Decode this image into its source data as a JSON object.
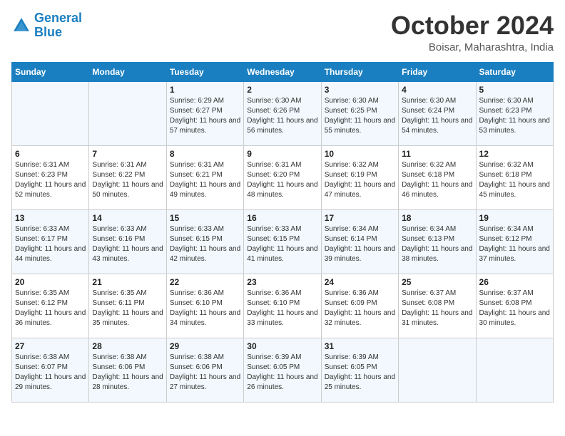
{
  "logo": {
    "line1": "General",
    "line2": "Blue"
  },
  "title": "October 2024",
  "location": "Boisar, Maharashtra, India",
  "days_of_week": [
    "Sunday",
    "Monday",
    "Tuesday",
    "Wednesday",
    "Thursday",
    "Friday",
    "Saturday"
  ],
  "weeks": [
    [
      {
        "day": "",
        "sunrise": "",
        "sunset": "",
        "daylight": ""
      },
      {
        "day": "",
        "sunrise": "",
        "sunset": "",
        "daylight": ""
      },
      {
        "day": "1",
        "sunrise": "Sunrise: 6:29 AM",
        "sunset": "Sunset: 6:27 PM",
        "daylight": "Daylight: 11 hours and 57 minutes."
      },
      {
        "day": "2",
        "sunrise": "Sunrise: 6:30 AM",
        "sunset": "Sunset: 6:26 PM",
        "daylight": "Daylight: 11 hours and 56 minutes."
      },
      {
        "day": "3",
        "sunrise": "Sunrise: 6:30 AM",
        "sunset": "Sunset: 6:25 PM",
        "daylight": "Daylight: 11 hours and 55 minutes."
      },
      {
        "day": "4",
        "sunrise": "Sunrise: 6:30 AM",
        "sunset": "Sunset: 6:24 PM",
        "daylight": "Daylight: 11 hours and 54 minutes."
      },
      {
        "day": "5",
        "sunrise": "Sunrise: 6:30 AM",
        "sunset": "Sunset: 6:23 PM",
        "daylight": "Daylight: 11 hours and 53 minutes."
      }
    ],
    [
      {
        "day": "6",
        "sunrise": "Sunrise: 6:31 AM",
        "sunset": "Sunset: 6:23 PM",
        "daylight": "Daylight: 11 hours and 52 minutes."
      },
      {
        "day": "7",
        "sunrise": "Sunrise: 6:31 AM",
        "sunset": "Sunset: 6:22 PM",
        "daylight": "Daylight: 11 hours and 50 minutes."
      },
      {
        "day": "8",
        "sunrise": "Sunrise: 6:31 AM",
        "sunset": "Sunset: 6:21 PM",
        "daylight": "Daylight: 11 hours and 49 minutes."
      },
      {
        "day": "9",
        "sunrise": "Sunrise: 6:31 AM",
        "sunset": "Sunset: 6:20 PM",
        "daylight": "Daylight: 11 hours and 48 minutes."
      },
      {
        "day": "10",
        "sunrise": "Sunrise: 6:32 AM",
        "sunset": "Sunset: 6:19 PM",
        "daylight": "Daylight: 11 hours and 47 minutes."
      },
      {
        "day": "11",
        "sunrise": "Sunrise: 6:32 AM",
        "sunset": "Sunset: 6:18 PM",
        "daylight": "Daylight: 11 hours and 46 minutes."
      },
      {
        "day": "12",
        "sunrise": "Sunrise: 6:32 AM",
        "sunset": "Sunset: 6:18 PM",
        "daylight": "Daylight: 11 hours and 45 minutes."
      }
    ],
    [
      {
        "day": "13",
        "sunrise": "Sunrise: 6:33 AM",
        "sunset": "Sunset: 6:17 PM",
        "daylight": "Daylight: 11 hours and 44 minutes."
      },
      {
        "day": "14",
        "sunrise": "Sunrise: 6:33 AM",
        "sunset": "Sunset: 6:16 PM",
        "daylight": "Daylight: 11 hours and 43 minutes."
      },
      {
        "day": "15",
        "sunrise": "Sunrise: 6:33 AM",
        "sunset": "Sunset: 6:15 PM",
        "daylight": "Daylight: 11 hours and 42 minutes."
      },
      {
        "day": "16",
        "sunrise": "Sunrise: 6:33 AM",
        "sunset": "Sunset: 6:15 PM",
        "daylight": "Daylight: 11 hours and 41 minutes."
      },
      {
        "day": "17",
        "sunrise": "Sunrise: 6:34 AM",
        "sunset": "Sunset: 6:14 PM",
        "daylight": "Daylight: 11 hours and 39 minutes."
      },
      {
        "day": "18",
        "sunrise": "Sunrise: 6:34 AM",
        "sunset": "Sunset: 6:13 PM",
        "daylight": "Daylight: 11 hours and 38 minutes."
      },
      {
        "day": "19",
        "sunrise": "Sunrise: 6:34 AM",
        "sunset": "Sunset: 6:12 PM",
        "daylight": "Daylight: 11 hours and 37 minutes."
      }
    ],
    [
      {
        "day": "20",
        "sunrise": "Sunrise: 6:35 AM",
        "sunset": "Sunset: 6:12 PM",
        "daylight": "Daylight: 11 hours and 36 minutes."
      },
      {
        "day": "21",
        "sunrise": "Sunrise: 6:35 AM",
        "sunset": "Sunset: 6:11 PM",
        "daylight": "Daylight: 11 hours and 35 minutes."
      },
      {
        "day": "22",
        "sunrise": "Sunrise: 6:36 AM",
        "sunset": "Sunset: 6:10 PM",
        "daylight": "Daylight: 11 hours and 34 minutes."
      },
      {
        "day": "23",
        "sunrise": "Sunrise: 6:36 AM",
        "sunset": "Sunset: 6:10 PM",
        "daylight": "Daylight: 11 hours and 33 minutes."
      },
      {
        "day": "24",
        "sunrise": "Sunrise: 6:36 AM",
        "sunset": "Sunset: 6:09 PM",
        "daylight": "Daylight: 11 hours and 32 minutes."
      },
      {
        "day": "25",
        "sunrise": "Sunrise: 6:37 AM",
        "sunset": "Sunset: 6:08 PM",
        "daylight": "Daylight: 11 hours and 31 minutes."
      },
      {
        "day": "26",
        "sunrise": "Sunrise: 6:37 AM",
        "sunset": "Sunset: 6:08 PM",
        "daylight": "Daylight: 11 hours and 30 minutes."
      }
    ],
    [
      {
        "day": "27",
        "sunrise": "Sunrise: 6:38 AM",
        "sunset": "Sunset: 6:07 PM",
        "daylight": "Daylight: 11 hours and 29 minutes."
      },
      {
        "day": "28",
        "sunrise": "Sunrise: 6:38 AM",
        "sunset": "Sunset: 6:06 PM",
        "daylight": "Daylight: 11 hours and 28 minutes."
      },
      {
        "day": "29",
        "sunrise": "Sunrise: 6:38 AM",
        "sunset": "Sunset: 6:06 PM",
        "daylight": "Daylight: 11 hours and 27 minutes."
      },
      {
        "day": "30",
        "sunrise": "Sunrise: 6:39 AM",
        "sunset": "Sunset: 6:05 PM",
        "daylight": "Daylight: 11 hours and 26 minutes."
      },
      {
        "day": "31",
        "sunrise": "Sunrise: 6:39 AM",
        "sunset": "Sunset: 6:05 PM",
        "daylight": "Daylight: 11 hours and 25 minutes."
      },
      {
        "day": "",
        "sunrise": "",
        "sunset": "",
        "daylight": ""
      },
      {
        "day": "",
        "sunrise": "",
        "sunset": "",
        "daylight": ""
      }
    ]
  ]
}
